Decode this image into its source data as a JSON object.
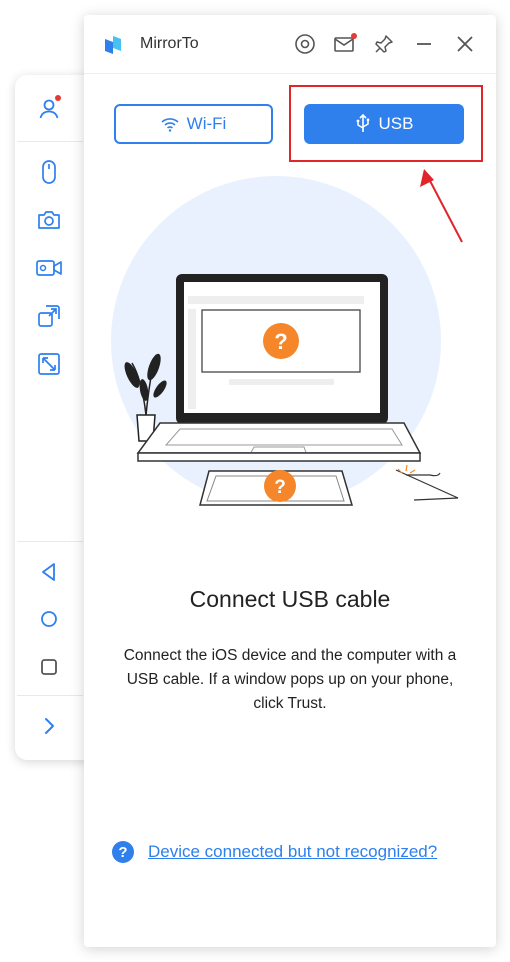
{
  "app": {
    "title": "MirrorTo"
  },
  "titlebar_icons": [
    "settings-icon",
    "mail-icon",
    "pin-icon",
    "minimize-icon",
    "close-icon"
  ],
  "sidebar_icons": [
    "user-icon",
    "mouse-icon",
    "camera-icon",
    "video-icon",
    "expand-icon",
    "fullscreen-icon",
    "back-icon",
    "home-icon",
    "recent-apps-icon",
    "chevron-right-icon"
  ],
  "connection": {
    "wifi_label": "Wi-Fi",
    "usb_label": "USB",
    "selected": "USB"
  },
  "illustration": {
    "question_mark": "?"
  },
  "content": {
    "title": "Connect USB cable",
    "description": "Connect the iOS device and the computer with a USB cable. If a window pops up on your phone, click Trust."
  },
  "help": {
    "icon_glyph": "?",
    "link_text": "Device connected but not recognized?"
  },
  "colors": {
    "accent": "#2f80ed",
    "annotation": "#e0262b",
    "notification_dot": "#e53935",
    "illustration_orange": "#f5862a",
    "illustration_circle": "#e8f1fd"
  }
}
